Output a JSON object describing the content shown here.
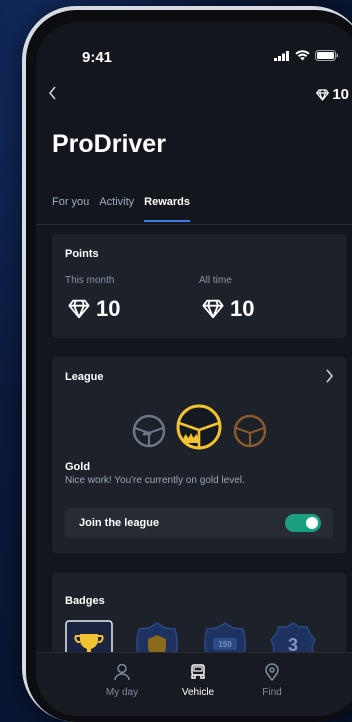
{
  "status": {
    "time": "9:41"
  },
  "header": {
    "gems": "10"
  },
  "page": {
    "title": "ProDriver"
  },
  "tabs": [
    {
      "label": "For you",
      "active": false
    },
    {
      "label": "Activity",
      "active": false
    },
    {
      "label": "Rewards",
      "active": true
    }
  ],
  "points": {
    "heading": "Points",
    "this_month_label": "This month",
    "this_month_value": "10",
    "all_time_label": "All time",
    "all_time_value": "10"
  },
  "league": {
    "heading": "League",
    "level": "Gold",
    "description": "Nice work! You're currently on gold level.",
    "join_label": "Join the league",
    "join_enabled": true
  },
  "badges": {
    "heading": "Badges",
    "numbers": [
      "150",
      "3"
    ]
  },
  "nav": [
    {
      "label": "My day",
      "active": false
    },
    {
      "label": "Vehicle",
      "active": true
    },
    {
      "label": "Find",
      "active": false
    }
  ],
  "colors": {
    "accent": "#3a7ce0",
    "gold": "#f2c230",
    "toggle": "#1a9f7f",
    "bronze": "#8a5a2a",
    "silver": "#6b7888"
  }
}
